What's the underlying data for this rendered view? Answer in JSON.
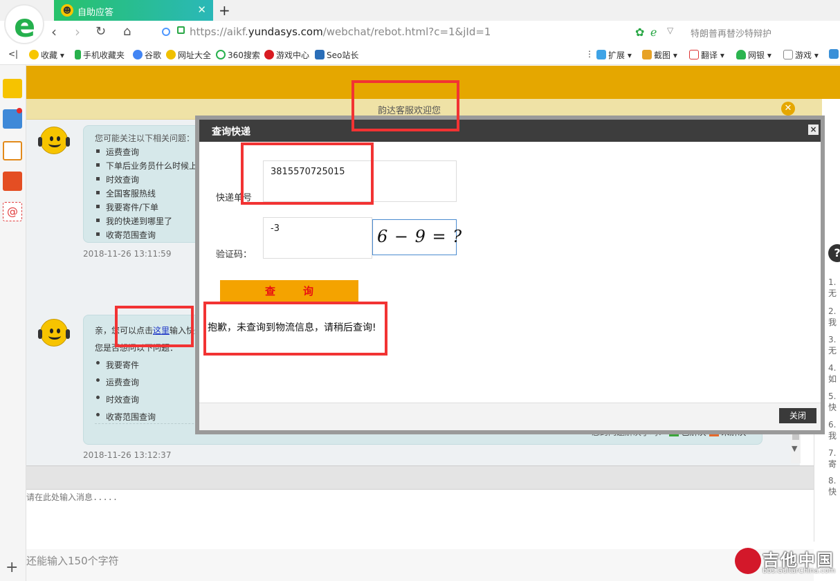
{
  "browser": {
    "tab_title": "自助应答",
    "url_prefix": "https://aikf.",
    "url_domain": "yundasys.com",
    "url_path": "/webchat/rebot.html?c=1&jId=1",
    "news_text": "特朗普再替沙特辩护",
    "bookmarks": [
      "收藏",
      "手机收藏夹",
      "谷歌",
      "网址大全",
      "360搜索",
      "游戏中心",
      "Seo站长"
    ],
    "tools": [
      "扩展",
      "截图",
      "翻译",
      "网银",
      "游戏"
    ]
  },
  "page": {
    "welcome": "韵达客服欢迎您",
    "msg1": {
      "intro": "您可能关注以下相关问题：",
      "items": [
        "运费查询",
        "下单后业务员什么时候上门",
        "时效查询",
        "全国客服热线",
        "我要寄件/下单",
        "我的快递到哪里了",
        "收寄范围查询"
      ],
      "time": "2018-11-26 13:11:59"
    },
    "msg2": {
      "line1_pre": "亲，您可以点击",
      "line1_link": "这里",
      "line1_post": "输入快递单号查询",
      "line2": "您是否想问以下问题：",
      "items": [
        "我要寄件",
        "运费查询",
        "时效查询",
        "收寄范围查询"
      ],
      "feedback_q": "您的问题解决了吗？",
      "resolved": "已解决",
      "unresolved": "未解决",
      "time": "2018-11-26 13:12:37"
    },
    "side_items": [
      "1. 无",
      "2. 我",
      "3. 无",
      "4. 如",
      "5. 快",
      "6. 我",
      "7. 寄",
      "8. 快"
    ],
    "input_placeholder": "请在此处输入消息.....",
    "counter": "还能输入150个字符"
  },
  "modal": {
    "title": "查询快递",
    "close_x": "×",
    "label_tracking": "快递单号",
    "tracking_value": "3815570725015",
    "label_captcha": "验证码：",
    "captcha_value": "-3",
    "captcha_image_text": "6 − 9 = ?",
    "query_button": "查询",
    "result": "抱歉，未查询到物流信息，请稍后查询!",
    "close_button": "关闭"
  },
  "watermark": {
    "cn": "吉他中国",
    "en": "bbs.GuitarChina.com"
  }
}
